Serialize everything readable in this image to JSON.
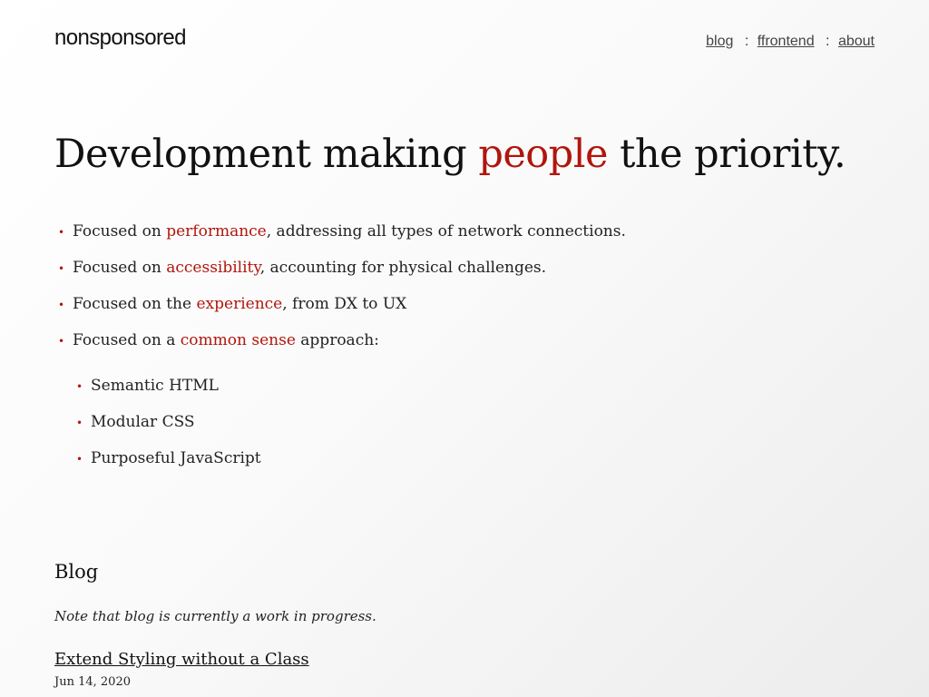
{
  "header": {
    "logo": "nonsponsored",
    "nav": [
      {
        "label": "blog"
      },
      {
        "label": "ffrontend"
      },
      {
        "label": "about"
      }
    ],
    "separator": ":"
  },
  "hero": {
    "prefix": "Development making ",
    "highlight": "people",
    "suffix": " the priority."
  },
  "focus": {
    "bullet": "•",
    "items": [
      {
        "prefix": "Focused on ",
        "highlight": "performance",
        "suffix": ", addressing all types of network connections."
      },
      {
        "prefix": "Focused on ",
        "highlight": "accessibility",
        "suffix": ", accounting for physical challenges."
      },
      {
        "prefix": "Focused on the ",
        "highlight": "experience",
        "suffix": ", from DX to UX"
      },
      {
        "prefix": "Focused on a ",
        "highlight": "common sense",
        "suffix": " approach:"
      }
    ],
    "subitems": [
      "Semantic HTML",
      "Modular CSS",
      "Purposeful JavaScript"
    ]
  },
  "blog": {
    "heading": "Blog",
    "note": "Note that blog is currently a work in progress.",
    "posts": [
      {
        "title": "Extend Styling without a Class",
        "date": "Jun 14, 2020"
      }
    ]
  },
  "colors": {
    "accent": "#b0160c",
    "text": "#111111"
  }
}
